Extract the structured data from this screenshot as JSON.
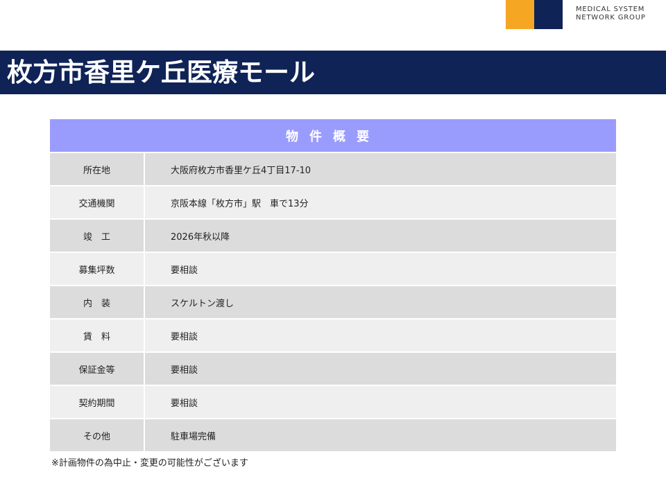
{
  "brand": {
    "line1": "MEDICAL SYSTEM",
    "line2": "NETWORK GROUP",
    "colors": {
      "orange": "#f5a623",
      "navy": "#0f2357"
    }
  },
  "title": "枚方市香里ケ丘医療モール",
  "table": {
    "header": "物件概要",
    "header_color": "#9a9cfd",
    "rows": [
      {
        "label": "所在地",
        "value": "大阪府枚方市香里ケ丘4丁目17-10"
      },
      {
        "label": "交通機関",
        "value": "京阪本線「枚方市」駅　車で13分"
      },
      {
        "label": "竣　工",
        "value": "2026年秋以降"
      },
      {
        "label": "募集坪数",
        "value": "要相談"
      },
      {
        "label": "内　装",
        "value": "スケルトン渡し"
      },
      {
        "label": "賃　料",
        "value": "要相談"
      },
      {
        "label": "保証金等",
        "value": "要相談"
      },
      {
        "label": "契約期間",
        "value": "要相談"
      },
      {
        "label": "その他",
        "value": "駐車場完備"
      }
    ]
  },
  "footnote": "※計画物件の為中止・変更の可能性がございます"
}
